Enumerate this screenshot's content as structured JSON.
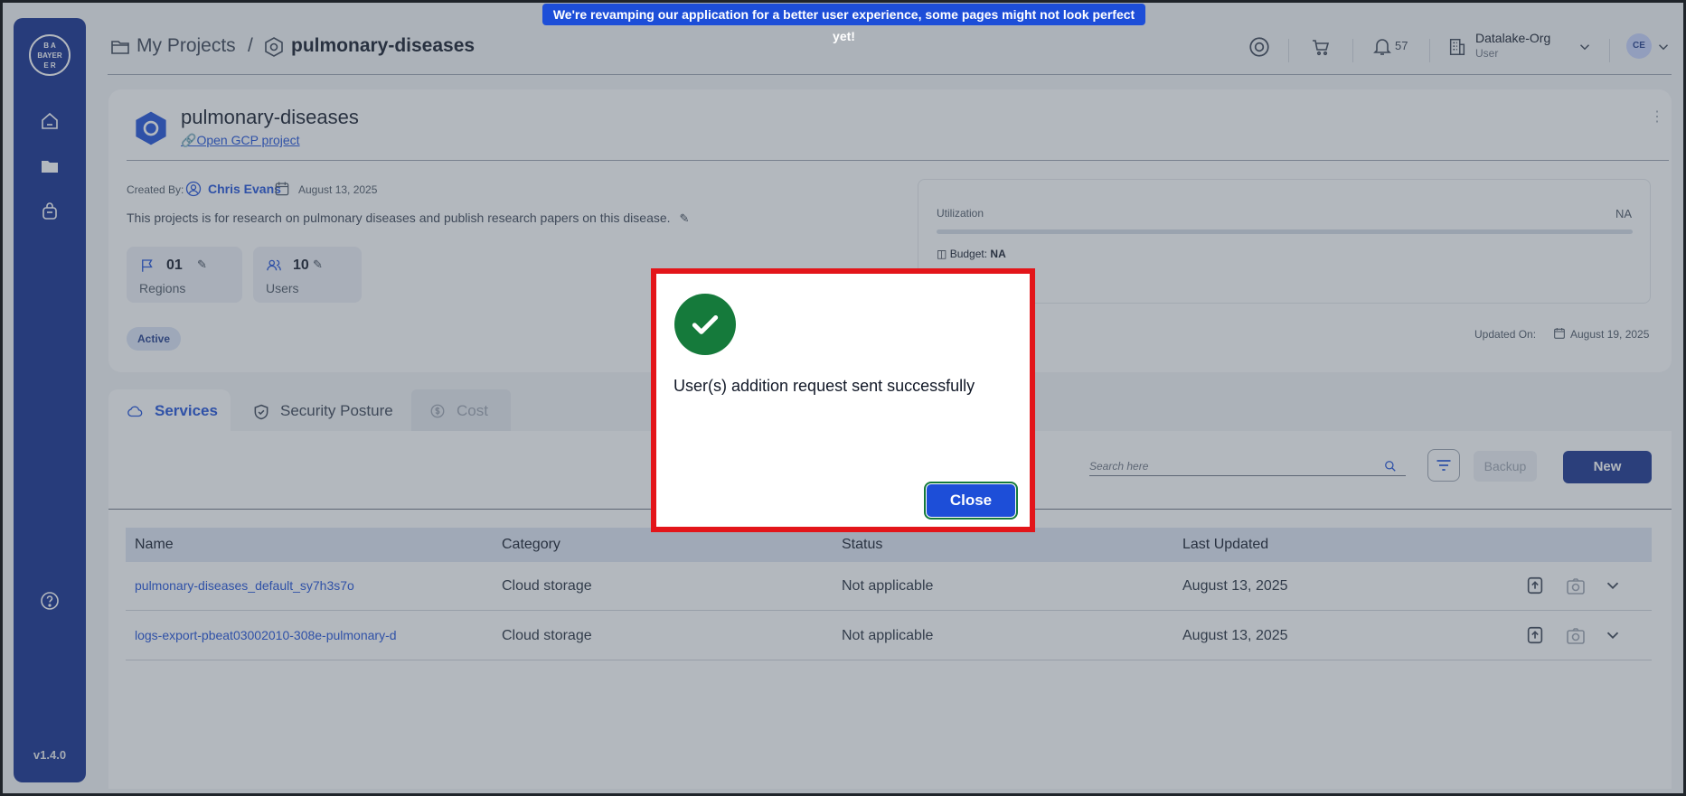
{
  "banner": "We're revamping our application for a better user experience, some pages might not look perfect yet!",
  "sidebar": {
    "logo_top": "B A",
    "logo_mid": "BAYER",
    "logo_bot": "E R",
    "version": "v1.4.0"
  },
  "header": {
    "crumb_root": "My Projects",
    "crumb_sep": "/",
    "crumb_current": "pulmonary-diseases",
    "notif_count": "57",
    "org_name": "Datalake-Org",
    "org_role": "User",
    "avatar": "CE"
  },
  "project": {
    "title": "pulmonary-diseases",
    "gcp_link": "Open GCP project",
    "created_by_label": "Created By:",
    "creator": "Chris Evans",
    "created_date": "August 13, 2025",
    "description": "This projects is for research on pulmonary diseases and publish research papers on this disease.",
    "regions_count": "01",
    "regions_label": "Regions",
    "users_count": "10",
    "users_label": "Users",
    "status": "Active",
    "utilization_label": "Utilization",
    "utilization_value": "NA",
    "utilization_fraction": 0,
    "budget_label": "Budget:",
    "budget_value": "NA",
    "updated_label": "Updated On:",
    "updated_date": "August 19, 2025"
  },
  "tabs": [
    {
      "label": "Services"
    },
    {
      "label": "Security Posture"
    },
    {
      "label": "Cost"
    }
  ],
  "toolbar": {
    "search_placeholder": "Search here",
    "backup": "Backup",
    "new": "New"
  },
  "table": {
    "columns": [
      "Name",
      "Category",
      "Status",
      "Last Updated"
    ],
    "rows": [
      {
        "name": "pulmonary-diseases_default_sy7h3s7o",
        "category": "Cloud storage",
        "status": "Not applicable",
        "updated": "August 13, 2025"
      },
      {
        "name": "logs-export-pbeat03002010-308e-pulmonary-d",
        "category": "Cloud storage",
        "status": "Not applicable",
        "updated": "August 13, 2025"
      }
    ]
  },
  "modal": {
    "message": "User(s) addition request sent successfully",
    "close": "Close"
  },
  "colors": {
    "sidebar": "#0f2a8c",
    "accent": "#1d4ed8",
    "success": "#157a3b",
    "highlight": "#e3151a"
  }
}
